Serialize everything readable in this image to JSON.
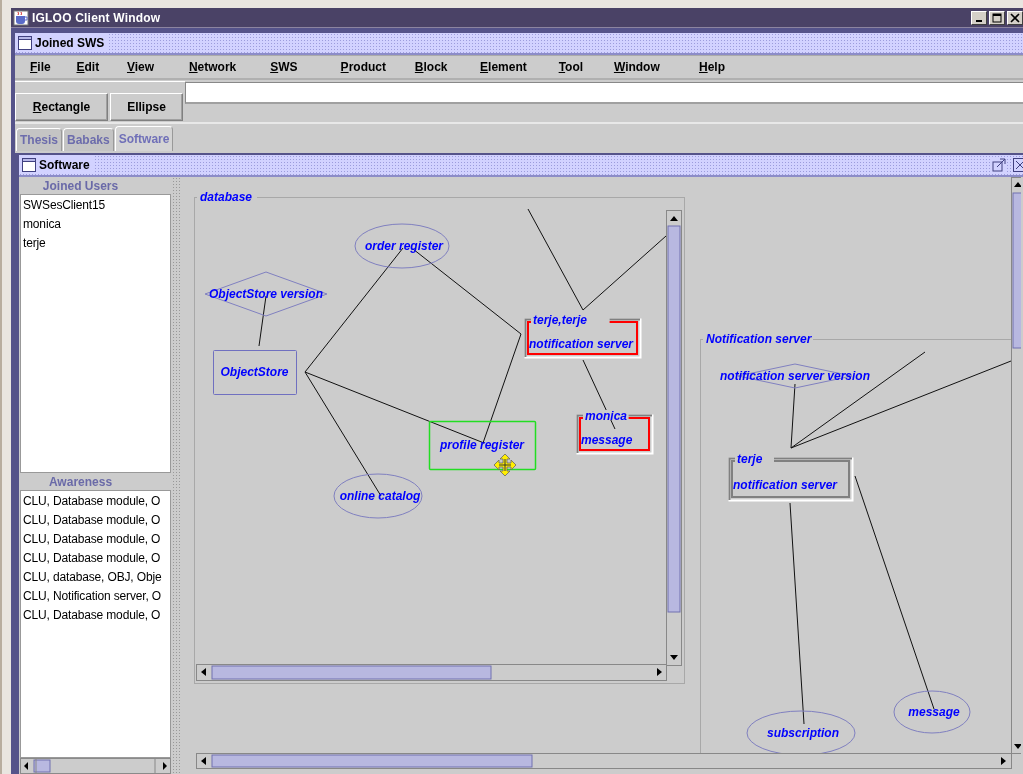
{
  "window": {
    "title": "IGLOO Client Window"
  },
  "workspace": {
    "title": "Joined SWS"
  },
  "menu": [
    "File",
    "Edit",
    "View",
    "Network",
    "SWS",
    "Product",
    "Block",
    "Element",
    "Tool",
    "Window",
    "Help"
  ],
  "toolbar": {
    "buttons": [
      "Rectangle",
      "Ellipse"
    ]
  },
  "tabs": [
    {
      "label": "Thesis",
      "selected": false
    },
    {
      "label": "Babaks",
      "selected": false
    },
    {
      "label": "Software",
      "selected": true
    }
  ],
  "frame": {
    "title": "Software"
  },
  "joined_users": {
    "title": "Joined Users",
    "items": [
      "SWSesClient15",
      "monica",
      "terje"
    ]
  },
  "awareness": {
    "title": "Awareness",
    "items": [
      "CLU, Database module, O",
      "CLU, Database module, O",
      "CLU, Database module, O",
      "CLU, Database module, O",
      "CLU, database, OBJ, Obje",
      "CLU, Notification server, O",
      "CLU, Database module, O"
    ]
  },
  "diagram": {
    "groups": [
      {
        "title": "database",
        "nodes": [
          {
            "kind": "ellipse",
            "label": "order register",
            "selected": false
          },
          {
            "kind": "diamond",
            "label": "ObjectStore version",
            "selected": false
          },
          {
            "kind": "rectangle",
            "label": "ObjectStore",
            "selected": false
          },
          {
            "kind": "user-box",
            "users": "terje,terje",
            "label": "notification server",
            "color": "#ff0000",
            "selected": false
          },
          {
            "kind": "user-box",
            "users": "monica",
            "label": "message",
            "color": "#ff0000",
            "selected": false
          },
          {
            "kind": "rectangle",
            "label": "profile register",
            "selected": true
          },
          {
            "kind": "ellipse",
            "label": "online catalog",
            "selected": false
          }
        ]
      },
      {
        "title": "Notification server",
        "nodes": [
          {
            "kind": "diamond",
            "label": "notification server version",
            "selected": false
          },
          {
            "kind": "user-box",
            "users": "terje",
            "label": "notification server",
            "color": "#808080",
            "selected": false
          },
          {
            "kind": "ellipse",
            "label": "subscription",
            "selected": false
          },
          {
            "kind": "ellipse",
            "label": "message",
            "selected": false
          }
        ]
      }
    ]
  }
}
